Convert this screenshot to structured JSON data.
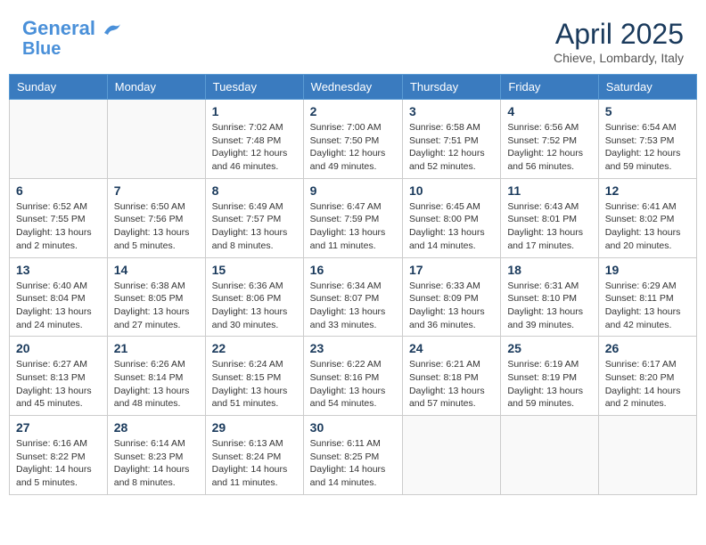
{
  "header": {
    "logo_line1": "General",
    "logo_line2": "Blue",
    "month_title": "April 2025",
    "location": "Chieve, Lombardy, Italy"
  },
  "weekdays": [
    "Sunday",
    "Monday",
    "Tuesday",
    "Wednesday",
    "Thursday",
    "Friday",
    "Saturday"
  ],
  "weeks": [
    [
      null,
      null,
      {
        "day": "1",
        "sunrise": "Sunrise: 7:02 AM",
        "sunset": "Sunset: 7:48 PM",
        "daylight": "Daylight: 12 hours and 46 minutes."
      },
      {
        "day": "2",
        "sunrise": "Sunrise: 7:00 AM",
        "sunset": "Sunset: 7:50 PM",
        "daylight": "Daylight: 12 hours and 49 minutes."
      },
      {
        "day": "3",
        "sunrise": "Sunrise: 6:58 AM",
        "sunset": "Sunset: 7:51 PM",
        "daylight": "Daylight: 12 hours and 52 minutes."
      },
      {
        "day": "4",
        "sunrise": "Sunrise: 6:56 AM",
        "sunset": "Sunset: 7:52 PM",
        "daylight": "Daylight: 12 hours and 56 minutes."
      },
      {
        "day": "5",
        "sunrise": "Sunrise: 6:54 AM",
        "sunset": "Sunset: 7:53 PM",
        "daylight": "Daylight: 12 hours and 59 minutes."
      }
    ],
    [
      {
        "day": "6",
        "sunrise": "Sunrise: 6:52 AM",
        "sunset": "Sunset: 7:55 PM",
        "daylight": "Daylight: 13 hours and 2 minutes."
      },
      {
        "day": "7",
        "sunrise": "Sunrise: 6:50 AM",
        "sunset": "Sunset: 7:56 PM",
        "daylight": "Daylight: 13 hours and 5 minutes."
      },
      {
        "day": "8",
        "sunrise": "Sunrise: 6:49 AM",
        "sunset": "Sunset: 7:57 PM",
        "daylight": "Daylight: 13 hours and 8 minutes."
      },
      {
        "day": "9",
        "sunrise": "Sunrise: 6:47 AM",
        "sunset": "Sunset: 7:59 PM",
        "daylight": "Daylight: 13 hours and 11 minutes."
      },
      {
        "day": "10",
        "sunrise": "Sunrise: 6:45 AM",
        "sunset": "Sunset: 8:00 PM",
        "daylight": "Daylight: 13 hours and 14 minutes."
      },
      {
        "day": "11",
        "sunrise": "Sunrise: 6:43 AM",
        "sunset": "Sunset: 8:01 PM",
        "daylight": "Daylight: 13 hours and 17 minutes."
      },
      {
        "day": "12",
        "sunrise": "Sunrise: 6:41 AM",
        "sunset": "Sunset: 8:02 PM",
        "daylight": "Daylight: 13 hours and 20 minutes."
      }
    ],
    [
      {
        "day": "13",
        "sunrise": "Sunrise: 6:40 AM",
        "sunset": "Sunset: 8:04 PM",
        "daylight": "Daylight: 13 hours and 24 minutes."
      },
      {
        "day": "14",
        "sunrise": "Sunrise: 6:38 AM",
        "sunset": "Sunset: 8:05 PM",
        "daylight": "Daylight: 13 hours and 27 minutes."
      },
      {
        "day": "15",
        "sunrise": "Sunrise: 6:36 AM",
        "sunset": "Sunset: 8:06 PM",
        "daylight": "Daylight: 13 hours and 30 minutes."
      },
      {
        "day": "16",
        "sunrise": "Sunrise: 6:34 AM",
        "sunset": "Sunset: 8:07 PM",
        "daylight": "Daylight: 13 hours and 33 minutes."
      },
      {
        "day": "17",
        "sunrise": "Sunrise: 6:33 AM",
        "sunset": "Sunset: 8:09 PM",
        "daylight": "Daylight: 13 hours and 36 minutes."
      },
      {
        "day": "18",
        "sunrise": "Sunrise: 6:31 AM",
        "sunset": "Sunset: 8:10 PM",
        "daylight": "Daylight: 13 hours and 39 minutes."
      },
      {
        "day": "19",
        "sunrise": "Sunrise: 6:29 AM",
        "sunset": "Sunset: 8:11 PM",
        "daylight": "Daylight: 13 hours and 42 minutes."
      }
    ],
    [
      {
        "day": "20",
        "sunrise": "Sunrise: 6:27 AM",
        "sunset": "Sunset: 8:13 PM",
        "daylight": "Daylight: 13 hours and 45 minutes."
      },
      {
        "day": "21",
        "sunrise": "Sunrise: 6:26 AM",
        "sunset": "Sunset: 8:14 PM",
        "daylight": "Daylight: 13 hours and 48 minutes."
      },
      {
        "day": "22",
        "sunrise": "Sunrise: 6:24 AM",
        "sunset": "Sunset: 8:15 PM",
        "daylight": "Daylight: 13 hours and 51 minutes."
      },
      {
        "day": "23",
        "sunrise": "Sunrise: 6:22 AM",
        "sunset": "Sunset: 8:16 PM",
        "daylight": "Daylight: 13 hours and 54 minutes."
      },
      {
        "day": "24",
        "sunrise": "Sunrise: 6:21 AM",
        "sunset": "Sunset: 8:18 PM",
        "daylight": "Daylight: 13 hours and 57 minutes."
      },
      {
        "day": "25",
        "sunrise": "Sunrise: 6:19 AM",
        "sunset": "Sunset: 8:19 PM",
        "daylight": "Daylight: 13 hours and 59 minutes."
      },
      {
        "day": "26",
        "sunrise": "Sunrise: 6:17 AM",
        "sunset": "Sunset: 8:20 PM",
        "daylight": "Daylight: 14 hours and 2 minutes."
      }
    ],
    [
      {
        "day": "27",
        "sunrise": "Sunrise: 6:16 AM",
        "sunset": "Sunset: 8:22 PM",
        "daylight": "Daylight: 14 hours and 5 minutes."
      },
      {
        "day": "28",
        "sunrise": "Sunrise: 6:14 AM",
        "sunset": "Sunset: 8:23 PM",
        "daylight": "Daylight: 14 hours and 8 minutes."
      },
      {
        "day": "29",
        "sunrise": "Sunrise: 6:13 AM",
        "sunset": "Sunset: 8:24 PM",
        "daylight": "Daylight: 14 hours and 11 minutes."
      },
      {
        "day": "30",
        "sunrise": "Sunrise: 6:11 AM",
        "sunset": "Sunset: 8:25 PM",
        "daylight": "Daylight: 14 hours and 14 minutes."
      },
      null,
      null,
      null
    ]
  ]
}
